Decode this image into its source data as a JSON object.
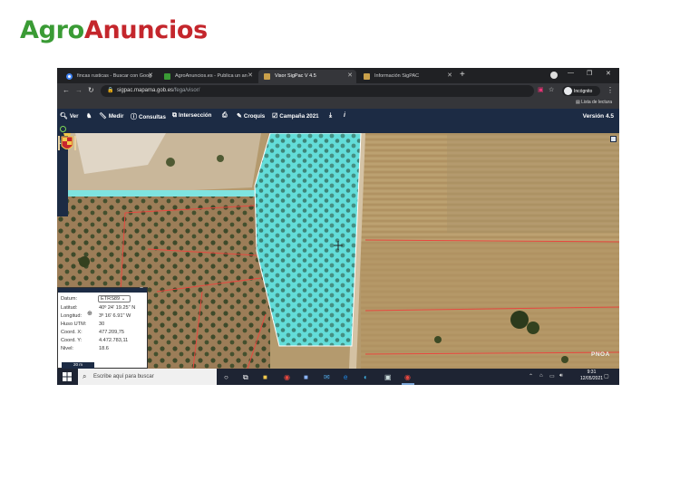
{
  "logo": {
    "part1": "Agro",
    "part2": "Anuncios"
  },
  "browser": {
    "tabs": [
      {
        "label": "fincas rusticas - Buscar con Goog"
      },
      {
        "label": "AgroAnuncios.es - Publica un an"
      },
      {
        "label": "Visor SigPac V 4.5"
      },
      {
        "label": "Información SigPAC"
      }
    ],
    "new_tab": "+",
    "url_domain": "sigpac.mapama.gob.es",
    "url_path": "/fega/visor/",
    "profile": "Incógnito",
    "reading_list": "Lista de lectura"
  },
  "sigpac": {
    "toolbar": [
      {
        "icon": "search-icon",
        "label": "Ver"
      },
      {
        "icon": "walker-icon",
        "label": ""
      },
      {
        "icon": "ruler-icon",
        "label": "Medir"
      },
      {
        "icon": "info-icon",
        "label": "Consultas"
      },
      {
        "icon": "intersect-icon",
        "label": "Intersección"
      },
      {
        "icon": "print-icon",
        "label": ""
      },
      {
        "icon": "pencil-icon",
        "label": "Croquis"
      },
      {
        "icon": "calendar-check-icon",
        "label": "Campaña 2021"
      },
      {
        "icon": "download-icon",
        "label": ""
      },
      {
        "icon": "info-italic-icon",
        "label": ""
      }
    ],
    "version": "Versión 4.5",
    "side_label": "18"
  },
  "info_panel": {
    "datum_label": "Datum:",
    "datum_value": "ETRS89",
    "lat_label": "Latitud:",
    "lat_value": "40º 24' 19.25\" N",
    "lon_label": "Longitud:",
    "lon_value": "3º 16' 6.91\" W",
    "huso_label": "Huso UTM:",
    "huso_value": "30",
    "x_label": "Coord. X:",
    "x_value": "477.209,75",
    "y_label": "Coord. Y:",
    "y_value": "4.472.783,11",
    "nivel_label": "Nivel:",
    "nivel_value": "18.6",
    "scale": "20 m"
  },
  "map": {
    "watermark": "PNOA",
    "parcel_color": "#5fe0df"
  },
  "taskbar": {
    "search_placeholder": "Escribe aquí para buscar",
    "time": "9:31",
    "date": "12/05/2021"
  }
}
